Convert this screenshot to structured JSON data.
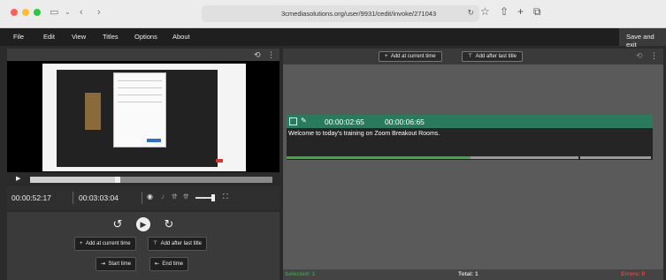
{
  "browser": {
    "url": "3cmediasolutions.org/user/9931/cedit/invoke/271043"
  },
  "menubar": {
    "items": [
      "File",
      "Edit",
      "View",
      "Titles",
      "Options",
      "About"
    ],
    "save_exit": "Save and exit"
  },
  "player": {
    "current_time": "00:00:52:17",
    "duration": "00:03:03:04",
    "progress_fraction": 0.36
  },
  "controls": {
    "add_current": "Add at current time",
    "add_after": "Add after last title",
    "start_time": "Start time",
    "end_time": "End time"
  },
  "subtitles": {
    "add_current": "Add at current time",
    "add_after": "Add after last title",
    "cue": {
      "start": "00:00:02:65",
      "end": "00:00:06:65",
      "text": "Welcome to today's training on Zoom Breakout Rooms."
    }
  },
  "status": {
    "selected": "Selected: 1",
    "total": "Total: 1",
    "errors": "Errors: 0",
    "colors": {
      "selected": "#2ea043",
      "total": "#dddddd",
      "errors": "#e0463c"
    }
  },
  "colors": {
    "accent": "#2a7a5c"
  }
}
